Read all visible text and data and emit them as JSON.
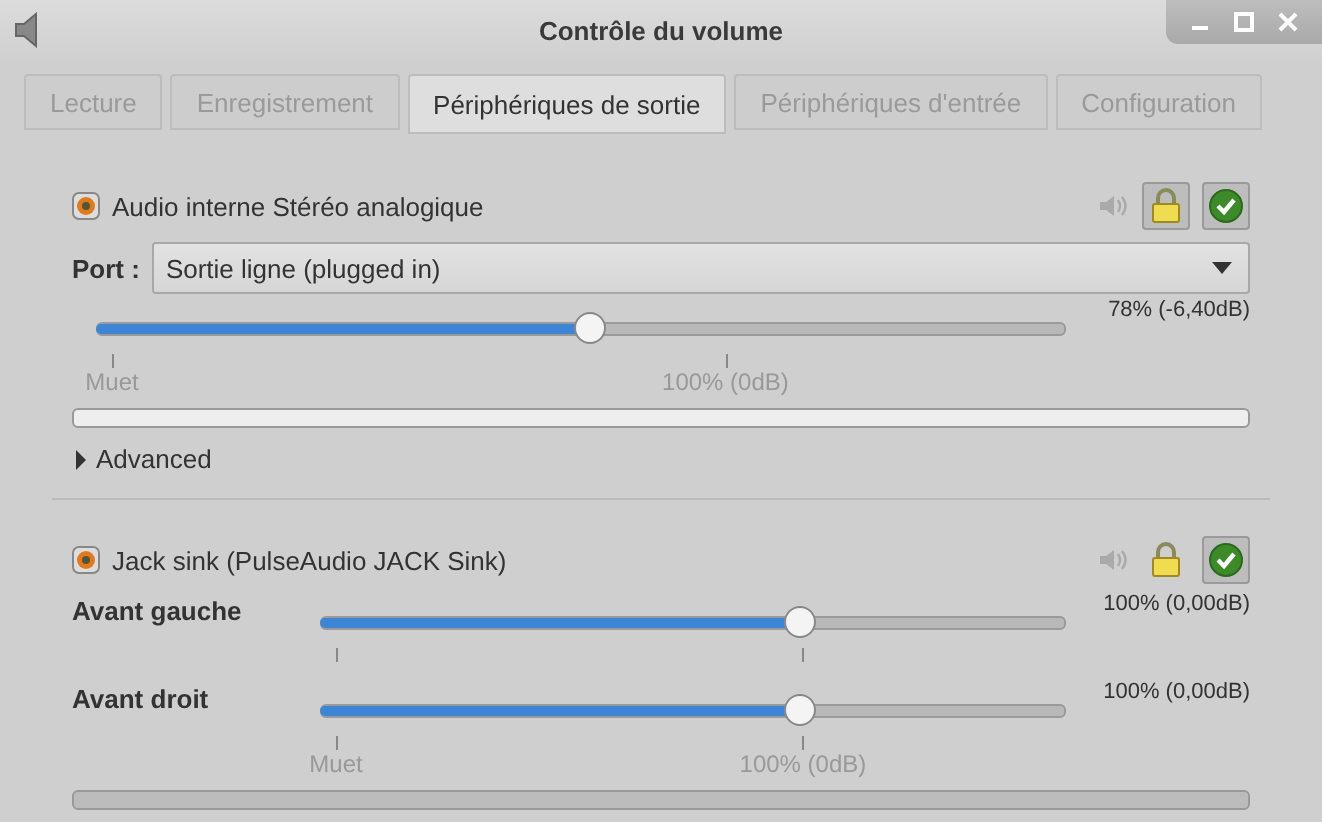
{
  "window": {
    "title": "Contrôle du volume"
  },
  "tabs": [
    {
      "label": "Lecture",
      "selected": false
    },
    {
      "label": "Enregistrement",
      "selected": false
    },
    {
      "label": "Périphériques de sortie",
      "selected": true
    },
    {
      "label": "Périphériques d'entrée",
      "selected": false
    },
    {
      "label": "Configuration",
      "selected": false
    }
  ],
  "devices": [
    {
      "name": "Audio interne Stéréo analogique",
      "lock_pressed": true,
      "default_pressed": true,
      "port": {
        "label": "Port :",
        "value": "Sortie ligne (plugged in)"
      },
      "channels": [
        {
          "level": 0.51,
          "reading": "78% (-6,40dB)"
        }
      ],
      "scale": [
        "Muet",
        "100% (0dB)"
      ],
      "meter_disabled": false,
      "advanced": {
        "label": "Advanced",
        "expanded": false
      }
    },
    {
      "name": "Jack sink (PulseAudio JACK Sink)",
      "lock_pressed": false,
      "default_pressed": true,
      "channels": [
        {
          "name": "Avant gauche",
          "level": 0.65,
          "reading": "100% (0,00dB)"
        },
        {
          "name": "Avant droit",
          "level": 0.65,
          "reading": "100% (0,00dB)"
        }
      ],
      "scale": [
        "Muet",
        "100% (0dB)"
      ],
      "meter_disabled": true
    }
  ]
}
